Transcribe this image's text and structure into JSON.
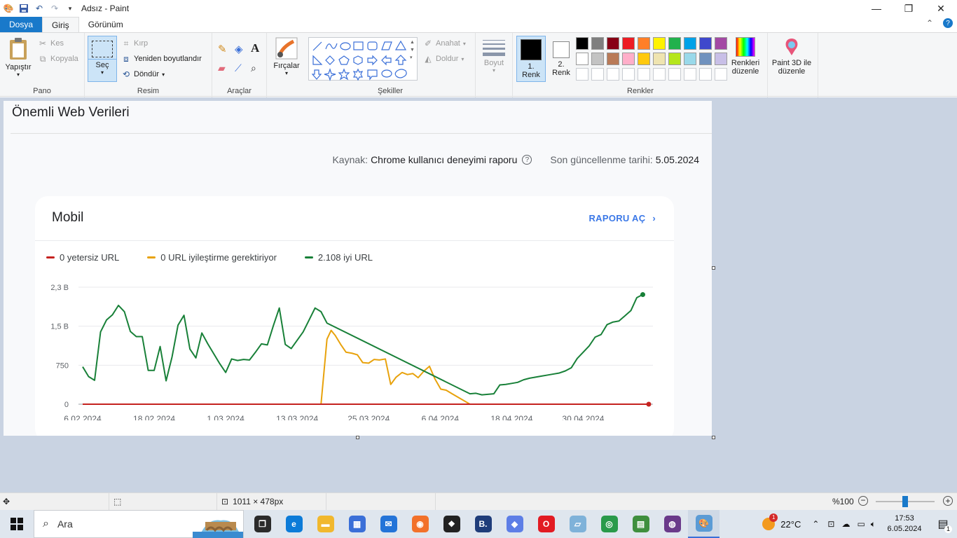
{
  "window": {
    "title": "Adsız - Paint",
    "controls": [
      "minimize-icon",
      "restore-icon",
      "close-icon"
    ]
  },
  "menu": {
    "file_tab": "Dosya",
    "tabs": [
      "Giriş",
      "Görünüm"
    ]
  },
  "ribbon": {
    "pano": {
      "label": "Pano",
      "paste": "Yapıştır",
      "cut": "Kes",
      "copy": "Kopyala"
    },
    "resim": {
      "label": "Resim",
      "select": "Seç",
      "crop": "Kırp",
      "resize": "Yeniden boyutlandır",
      "rotate": "Döndür"
    },
    "araclar": {
      "label": "Araçlar"
    },
    "brushes": "Fırçalar",
    "sekiller": {
      "label": "Şekiller",
      "outline": "Anahat",
      "fill": "Doldur"
    },
    "size": "Boyut",
    "renkler": {
      "label": "Renkler",
      "color1": "1. Renk",
      "color2": "2. Renk",
      "edit_colors": "Renkleri düzenle",
      "paint3d": "Paint 3D ile düzenle",
      "palette_row1": [
        "#000000",
        "#7f7f7f",
        "#880015",
        "#ed1c24",
        "#ff7f27",
        "#fff200",
        "#22b14c",
        "#00a2e8",
        "#3f48cc",
        "#a349a4"
      ],
      "palette_row2": [
        "#ffffff",
        "#c3c3c3",
        "#b97a57",
        "#ffaec9",
        "#ffc90e",
        "#efe4b0",
        "#b5e61d",
        "#99d9ea",
        "#7092be",
        "#c8bfe7"
      ],
      "color1_value": "#000000",
      "color2_value": "#ffffff"
    }
  },
  "canvas": {
    "heading": "Önemli Web Verileri",
    "source_label": "Kaynak:",
    "source_value": "Chrome kullanıcı deneyimi raporu",
    "updated_label": "Son güncellenme tarihi:",
    "updated_value": "5.05.2024",
    "card": {
      "title": "Mobil",
      "open_report": "RAPORU AÇ",
      "legend": [
        {
          "label": "0 yetersiz URL",
          "color": "#c5221f"
        },
        {
          "label": "0 URL iyileştirme gerektiriyor",
          "color": "#e8a20c"
        },
        {
          "label": "2.108 iyi URL",
          "color": "#188038"
        }
      ]
    }
  },
  "chart_data": {
    "type": "line",
    "x": [
      "6.02.2024",
      "18.02.2024",
      "1.03.2024",
      "13.03.2024",
      "25.03.2024",
      "6.04.2024",
      "18.04.2024",
      "30.04.2024"
    ],
    "xlabel": "",
    "ylabel": "",
    "y_ticks": [
      "0",
      "750",
      "1,5 B",
      "2,3 B"
    ],
    "ylim": [
      0,
      2250
    ],
    "grid": true,
    "series": [
      {
        "name": "0 yetersiz URL",
        "color": "#c5221f",
        "x_days": [
          0,
          20,
          40,
          60,
          80,
          95
        ],
        "values": [
          0,
          0,
          0,
          0,
          0,
          0
        ]
      },
      {
        "name": "0 URL iyileştirme gerektiriyor",
        "color": "#e8a20c",
        "x_days": [
          0,
          40,
          41,
          41.7,
          42.4,
          43.3,
          44.2,
          45.2,
          46.1,
          47,
          48,
          48.9,
          49.8,
          50.8,
          51.7,
          52.6,
          53.6,
          54.5,
          55.4,
          56.3,
          57.3,
          58.2,
          59.1,
          60.1,
          61,
          62,
          65,
          66,
          95
        ],
        "values": [
          0,
          0,
          1250,
          1420,
          1320,
          1150,
          1000,
          980,
          950,
          800,
          790,
          860,
          850,
          870,
          380,
          520,
          610,
          570,
          590,
          510,
          640,
          730,
          490,
          290,
          270,
          200,
          0,
          0,
          0
        ]
      },
      {
        "name": "2.108 iyi URL",
        "color": "#188038",
        "x_days": [
          0,
          1,
          2,
          3,
          4,
          5,
          6,
          7,
          8,
          9,
          10,
          11,
          12,
          13,
          14,
          15,
          16,
          17,
          18,
          19,
          20,
          21,
          22,
          23,
          24,
          25,
          26,
          27,
          28,
          29,
          30,
          31,
          32,
          33,
          34,
          35,
          36,
          37,
          38,
          39,
          40,
          41,
          65,
          66,
          67,
          68,
          69,
          70,
          71,
          72,
          73,
          74,
          75,
          76,
          77,
          78,
          79,
          80,
          81,
          82,
          83,
          84,
          85,
          86,
          87,
          88,
          89,
          90,
          91,
          92,
          93,
          94
        ],
        "values": [
          720,
          530,
          460,
          1390,
          1620,
          1720,
          1900,
          1780,
          1400,
          1300,
          1300,
          650,
          650,
          1110,
          450,
          910,
          1520,
          1710,
          1060,
          890,
          1370,
          1160,
          970,
          780,
          610,
          870,
          840,
          860,
          850,
          1000,
          1160,
          1140,
          1510,
          1850,
          1150,
          1070,
          1230,
          1390,
          1620,
          1850,
          1780,
          1560,
          200,
          210,
          180,
          190,
          200,
          370,
          380,
          400,
          420,
          470,
          500,
          520,
          540,
          560,
          580,
          600,
          640,
          700,
          880,
          1000,
          1120,
          1290,
          1340,
          1530,
          1580,
          1600,
          1700,
          1800,
          2050,
          2108
        ]
      }
    ]
  },
  "statusbar": {
    "dimensions": "1011 × 478px",
    "zoom": "%100",
    "zoom_level": 0.5
  },
  "taskbar": {
    "search_placeholder": "Ara",
    "weather": "22°C",
    "weather_badge": "1",
    "time": "17:53",
    "date": "6.05.2024",
    "notification_count": "1",
    "apps": [
      {
        "name": "task-view",
        "color": "#2b2b2b"
      },
      {
        "name": "edge",
        "color": "#0c7bd8"
      },
      {
        "name": "file-explorer",
        "color": "#f1b82e"
      },
      {
        "name": "microsoft-store",
        "color": "#3a6fd8"
      },
      {
        "name": "mail",
        "color": "#2474d8"
      },
      {
        "name": "firefox",
        "color": "#f2712a"
      },
      {
        "name": "dropbox",
        "color": "#222222"
      },
      {
        "name": "booking",
        "color": "#1f3d7a"
      },
      {
        "name": "copilot-app",
        "color": "#5d7ee6"
      },
      {
        "name": "opera",
        "color": "#e21b23"
      },
      {
        "name": "notes-app",
        "color": "#7fb2d9"
      },
      {
        "name": "chrome",
        "color": "#2a9a4a"
      },
      {
        "name": "sheets-app",
        "color": "#3f8f3e"
      },
      {
        "name": "tor-app",
        "color": "#6a3a8a"
      },
      {
        "name": "paint",
        "color": "#5b9bd5"
      }
    ]
  }
}
